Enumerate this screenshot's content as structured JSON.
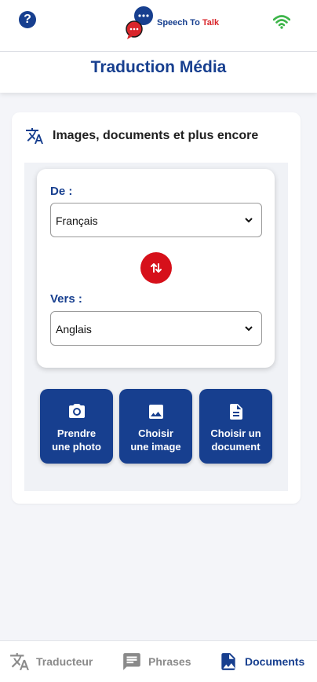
{
  "header": {
    "logo_text_a": "Speech To ",
    "logo_text_b": "Talk",
    "title": "Traduction Média"
  },
  "card": {
    "title": "Images, documents et plus encore",
    "from_label": "De :",
    "from_value": "Français",
    "to_label": "Vers :",
    "to_value": "Anglais"
  },
  "actions": [
    {
      "label": "Prendre\nune photo",
      "icon": "camera-icon"
    },
    {
      "label": "Choisir\nune image",
      "icon": "image-icon"
    },
    {
      "label": "Choisir un\ndocument",
      "icon": "document-icon"
    }
  ],
  "nav": {
    "items": [
      {
        "label": "Traducteur",
        "icon": "translate-icon",
        "active": false
      },
      {
        "label": "Phrases",
        "icon": "chat-icon",
        "active": false
      },
      {
        "label": "Documents",
        "icon": "image-document-icon",
        "active": true
      }
    ]
  },
  "colors": {
    "brand_blue": "#173f8f",
    "accent_red": "#d6101a",
    "wifi_green": "#3db54a"
  }
}
